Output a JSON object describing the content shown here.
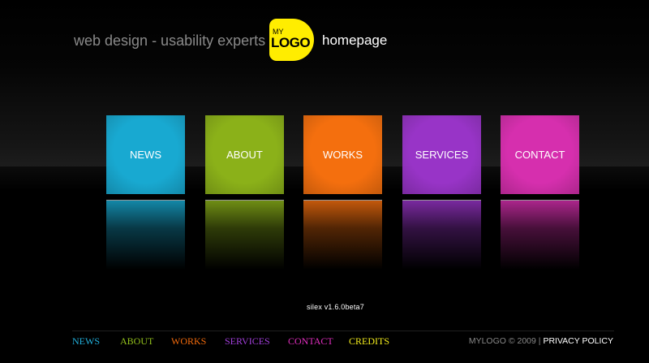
{
  "header": {
    "tagline": "web design - usability experts",
    "logo_small": "MY",
    "logo_big": "LOGO",
    "page_title": "homepage",
    "logo_color": "#ffed00"
  },
  "tiles": [
    {
      "label": "NEWS",
      "color": "#18a9d1"
    },
    {
      "label": "ABOUT",
      "color": "#8bb119"
    },
    {
      "label": "WORKS",
      "color": "#f46f0e"
    },
    {
      "label": "SERVICES",
      "color": "#9834c7"
    },
    {
      "label": "CONTACT",
      "color": "#d62fae"
    }
  ],
  "version": "silex v1.6.0beta7",
  "footer": {
    "nav": [
      {
        "label": "NEWS",
        "color": "#22b0dc"
      },
      {
        "label": "ABOUT",
        "color": "#93c11c"
      },
      {
        "label": "WORKS",
        "color": "#f26a0c"
      },
      {
        "label": "SERVICES",
        "color": "#a23fdb"
      },
      {
        "label": "CONTACT",
        "color": "#e22ec0"
      },
      {
        "label": "CREDITS",
        "color": "#f5ee1c"
      }
    ],
    "copyright": "MYLOGO © 2009",
    "separator": "|",
    "privacy": "PRIVACY POLICY"
  }
}
